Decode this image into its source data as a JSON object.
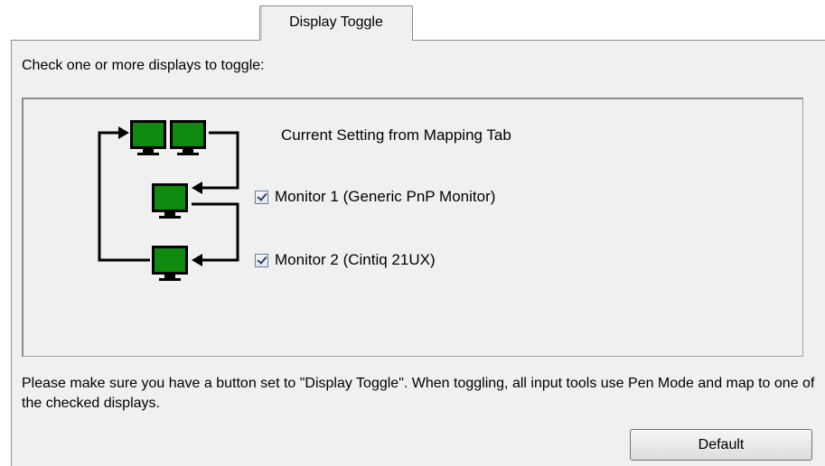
{
  "tab": {
    "label": "Display Toggle"
  },
  "instruction": "Check one or more displays to toggle:",
  "current_setting": "Current Setting from Mapping Tab",
  "monitors": [
    {
      "label": "Monitor 1 (Generic PnP Monitor)",
      "checked": true
    },
    {
      "label": "Monitor 2 (Cintiq 21UX)",
      "checked": true
    }
  ],
  "note": "Please make sure you have a button set to \"Display Toggle\". When toggling, all input tools use Pen Mode and map to one of the checked displays.",
  "buttons": {
    "default_label": "Default"
  },
  "colors": {
    "monitor_green": "#0f8a0f",
    "panel_bg": "#f0f0f0"
  }
}
